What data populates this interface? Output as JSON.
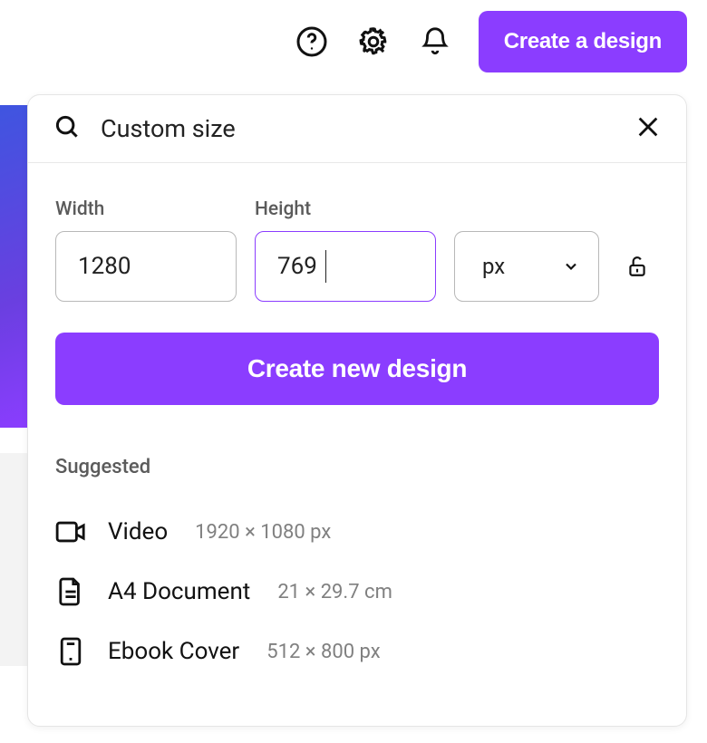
{
  "topbar": {
    "create_design_label": "Create a design"
  },
  "popover": {
    "title": "Custom size",
    "width_label": "Width",
    "height_label": "Height",
    "width_value": "1280",
    "height_value": "769",
    "unit_value": "px",
    "create_new_label": "Create new design"
  },
  "suggested": {
    "heading": "Suggested",
    "items": [
      {
        "name": "Video",
        "dims": "1920 × 1080 px",
        "icon": "video-icon"
      },
      {
        "name": "A4 Document",
        "dims": "21 × 29.7 cm",
        "icon": "document-icon"
      },
      {
        "name": "Ebook Cover",
        "dims": "512 × 800 px",
        "icon": "ebook-icon"
      }
    ]
  }
}
